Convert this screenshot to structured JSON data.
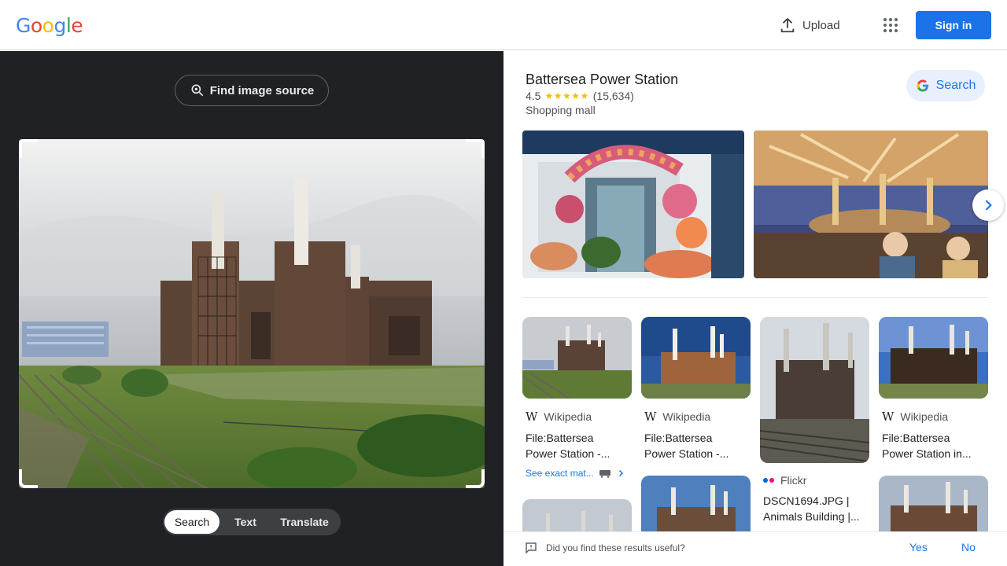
{
  "header": {
    "logo_letters": [
      "G",
      "o",
      "o",
      "g",
      "l",
      "e"
    ],
    "logo_colors": [
      "#4285f4",
      "#ea4335",
      "#fbbc05",
      "#4285f4",
      "#34a853",
      "#ea4335"
    ],
    "upload_label": "Upload",
    "upload_icon": "upload-icon",
    "apps_icon": "apps-grid-icon",
    "signin_label": "Sign in"
  },
  "left": {
    "find_source_label": "Find image source",
    "modes": [
      "Search",
      "Text",
      "Translate"
    ],
    "active_mode": "Search"
  },
  "place": {
    "title": "Battersea Power Station",
    "rating": "4.5",
    "stars": "★★★★★",
    "review_count": "(15,634)",
    "type": "Shopping mall",
    "search_label": "Search"
  },
  "results": [
    {
      "source": "Wikipedia",
      "source_icon": "wikipedia-icon",
      "title_line1": "File:Battersea",
      "title_line2": "Power Station -..."
    },
    {
      "source": "Wikipedia",
      "source_icon": "wikipedia-icon",
      "title_line1": "File:Battersea",
      "title_line2": "Power Station -..."
    },
    {
      "source": "Flickr",
      "source_icon": "flickr-icon",
      "title_line1": "DSCN1694.JPG |",
      "title_line2": "Animals Building |..."
    },
    {
      "source": "Wikipedia",
      "source_icon": "wikipedia-icon",
      "title_line1": "File:Battersea",
      "title_line2": "Power Station in..."
    }
  ],
  "see_exact_matches": "See exact mat...",
  "feedback": {
    "question": "Did you find these results useful?",
    "yes": "Yes",
    "no": "No"
  },
  "colors": {
    "accent": "#1a73e8",
    "dark_panel": "#202124",
    "star": "#fbbc04"
  }
}
